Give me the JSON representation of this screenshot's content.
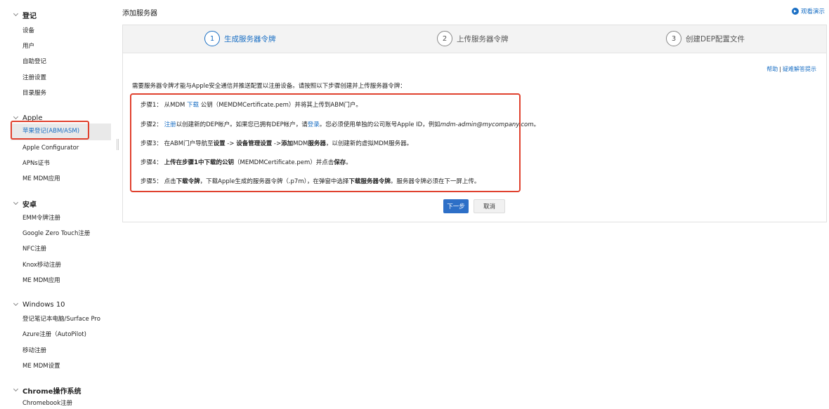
{
  "sidebar": {
    "sections": [
      {
        "label": "登记",
        "items": [
          "设备",
          "用户",
          "自助登记",
          "注册设置",
          "目录服务"
        ]
      },
      {
        "label": "Apple",
        "items": [
          "苹果登记(ABM/ASM)",
          "Apple Configurator",
          "APNs证书",
          "ME MDM应用"
        ]
      },
      {
        "label": "安卓",
        "items": [
          "EMM令牌注册",
          "Google Zero Touch注册",
          "NFC注册",
          "Knox移动注册",
          "ME MDM应用"
        ]
      },
      {
        "label": "Windows 10",
        "items": [
          "登记笔记本电脑/Surface Pro",
          "Azure注册（AutoPilot)",
          "移动注册",
          "ME MDM设置"
        ]
      },
      {
        "label": "Chrome操作系统",
        "items": [
          "Chromebook注册"
        ]
      }
    ]
  },
  "header": {
    "title": "添加服务器",
    "watch_demo": "观看演示"
  },
  "stepper": [
    {
      "num": "1",
      "label": "生成服务器令牌"
    },
    {
      "num": "2",
      "label": "上传服务器令牌"
    },
    {
      "num": "3",
      "label": "创建DEP配置文件"
    }
  ],
  "help": {
    "help": "帮助",
    "sep": "|",
    "troubleshoot": "疑难解答提示"
  },
  "intro": "需要服务器令牌才能与Apple安全通信并推送配置以注册设备。请按照以下步骤创建并上传服务器令牌：",
  "steps": {
    "s1": {
      "a": "步骤1：  从MDM ",
      "link": "下载",
      "b": " 公钥（MEMDMCertificate.pem）并将其上传到ABM门户。"
    },
    "s2": {
      "a": "步骤2：  ",
      "link1": "注册",
      "b": "以创建新的DEP帐户。如果您已拥有DEP帐户，请",
      "link2": "登录",
      "c": "。您必须使用单独的公司账号Apple ID，例如",
      "email": "mdm-admin@mycompany.com",
      "d": "。"
    },
    "s3": {
      "a": "步骤3：  在ABM门户导航至",
      "b1": "设置",
      "c": " -> ",
      "b2": "设备管理设置",
      "d": " ->",
      "b3": "添加",
      "e": "MDM",
      "b4": "服务器",
      "f": "，以创建新的虚拟MDM服务器。"
    },
    "s4": {
      "a": "步骤4：  ",
      "b1": "上传在步骤1中下载的公钥",
      "c": "（MEMDMCertificate.pem）并点击",
      "b2": "保存",
      "d": "。"
    },
    "s5": {
      "a": "步骤5：  点击",
      "b1": "下载令牌",
      "c": "，下载Apple生成的服务器令牌（.p7m），在弹窗中选择",
      "b2": "下载服务器令牌",
      "d": "。服务器令牌必须在下一屏上传。"
    }
  },
  "buttons": {
    "next": "下一步",
    "cancel": "取消"
  },
  "colors": {
    "accent": "#1a6fc4",
    "highlight_border": "#e0412e",
    "primary_button": "#2d6fc7"
  }
}
